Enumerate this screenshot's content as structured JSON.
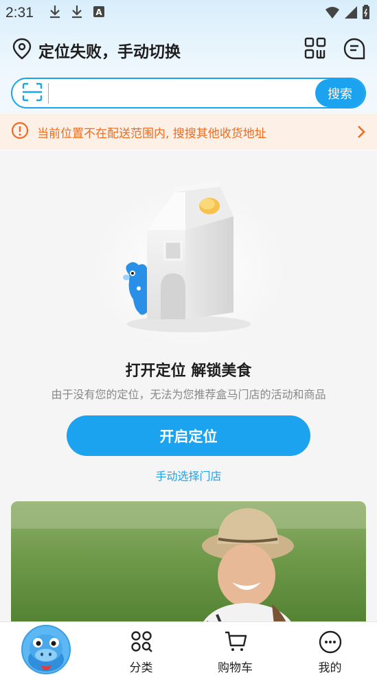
{
  "status_bar": {
    "time": "2:31",
    "icons": [
      "download-icon",
      "download-icon",
      "a-box-icon",
      "wifi-icon",
      "signal-icon",
      "battery-icon"
    ]
  },
  "header": {
    "location_text": "定位失败，手动切换",
    "icons": [
      "location-pin-icon",
      "qr-code-icon",
      "message-icon"
    ]
  },
  "search": {
    "placeholder": "",
    "button_label": "搜索"
  },
  "alert": {
    "text": "当前位置不在配送范围内, 搜搜其他收货地址"
  },
  "empty_state": {
    "title": "打开定位 解锁美食",
    "subtitle": "由于没有您的定位，无法为您推荐盒马门店的活动和商品",
    "primary_button": "开启定位",
    "link": "手动选择门店"
  },
  "tabs": [
    {
      "label": "",
      "icon": "hippo-mascot-icon"
    },
    {
      "label": "分类",
      "icon": "category-grid-icon"
    },
    {
      "label": "购物车",
      "icon": "cart-icon"
    },
    {
      "label": "我的",
      "icon": "profile-face-icon"
    }
  ],
  "colors": {
    "accent": "#1ba3ef",
    "alert_text": "#f06a1d",
    "alert_bg": "#fdf1e7"
  }
}
